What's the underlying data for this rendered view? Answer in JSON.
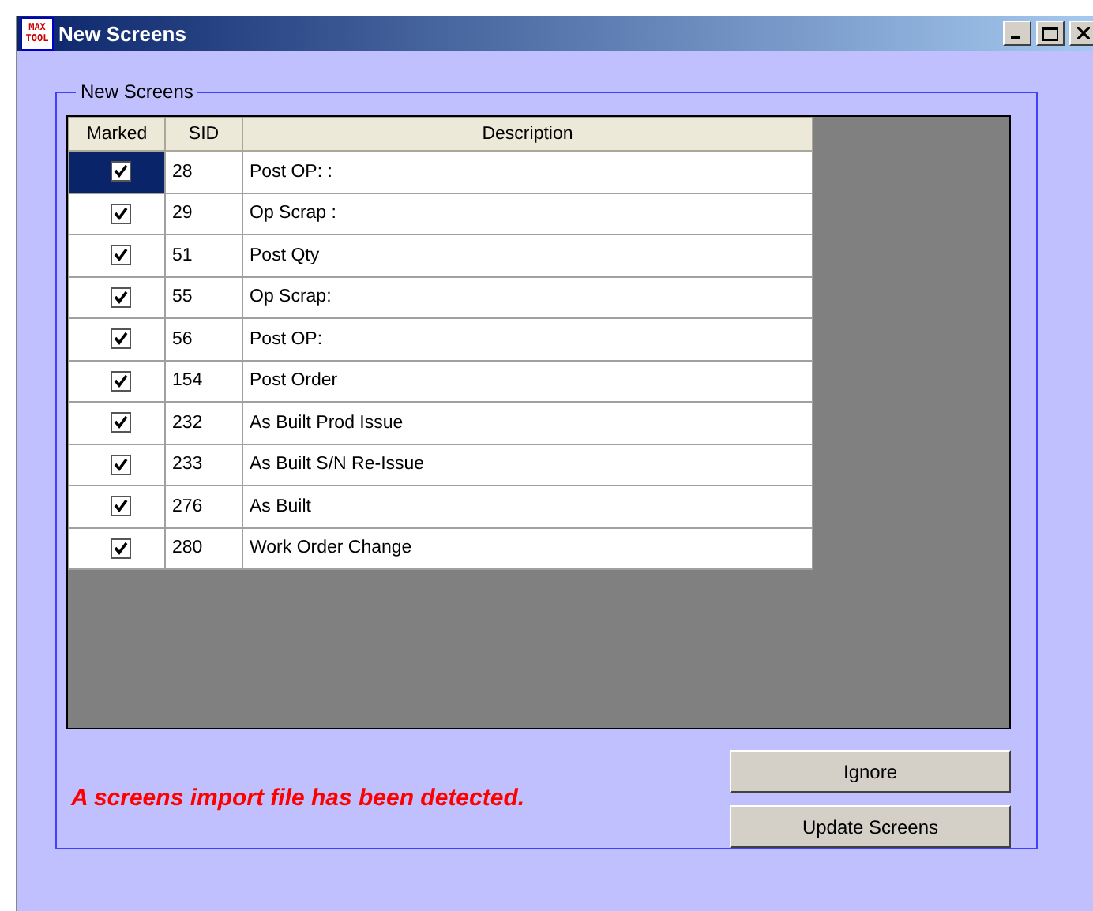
{
  "window": {
    "title": "New Screens",
    "logo": [
      "MAX",
      "TOOL"
    ]
  },
  "group": {
    "title": "New Screens"
  },
  "table": {
    "columns": [
      "Marked",
      "SID",
      "Description"
    ],
    "rows": [
      {
        "checked": true,
        "selected": true,
        "sid": "28",
        "description": "Post OP:   :"
      },
      {
        "checked": true,
        "selected": false,
        "sid": "29",
        "description": "Op Scrap   :"
      },
      {
        "checked": true,
        "selected": false,
        "sid": "51",
        "description": "Post Qty"
      },
      {
        "checked": true,
        "selected": false,
        "sid": "55",
        "description": "Op Scrap:"
      },
      {
        "checked": true,
        "selected": false,
        "sid": "56",
        "description": "Post OP:"
      },
      {
        "checked": true,
        "selected": false,
        "sid": "154",
        "description": "Post Order"
      },
      {
        "checked": true,
        "selected": false,
        "sid": "232",
        "description": "As Built Prod Issue"
      },
      {
        "checked": true,
        "selected": false,
        "sid": "233",
        "description": "As Built S/N Re-Issue"
      },
      {
        "checked": true,
        "selected": false,
        "sid": "276",
        "description": "As Built"
      },
      {
        "checked": true,
        "selected": false,
        "sid": "280",
        "description": "Work Order Change"
      }
    ]
  },
  "message": "A screens import file has been detected.",
  "buttons": [
    "Ignore",
    "Update Screens"
  ]
}
